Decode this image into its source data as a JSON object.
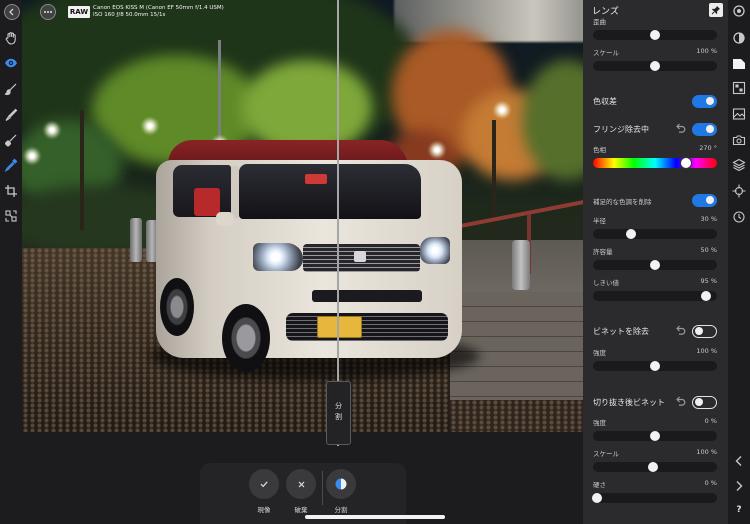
{
  "accent_color": "#1f78e3",
  "topbar": {
    "back_icon": "back-chevron-icon",
    "more_icon": "more-dots-icon",
    "raw_badge": "RAW",
    "camera_line1": "Canon EOS KISS M (Canon EF 50mm f/1.4 USM)",
    "camera_line2": "ISO 160 ƒ/8 50.0mm 15/1s"
  },
  "tools": [
    "hand-icon",
    "eye-icon",
    "brush-icon",
    "eraser-brush-icon",
    "gradient-brush-icon",
    "eyedropper-icon",
    "crop-icon",
    "red-eye-icon"
  ],
  "active_tool": "eye-icon",
  "split_handle": {
    "label": "分割"
  },
  "bottom_bar": {
    "buttons": [
      {
        "label": "現像",
        "icon": "check-icon"
      },
      {
        "label": "破棄",
        "icon": "close-icon"
      },
      {
        "label": "分割",
        "icon": "split-view-icon"
      }
    ]
  },
  "panel": {
    "title": "レンズ",
    "pin_icon": "pin-icon",
    "distortion": {
      "label": "歪曲",
      "fill": 0.5
    },
    "scale": {
      "label": "スケール",
      "value": "100 %",
      "fill": 0.5
    },
    "chromatic": {
      "label": "色収差",
      "on": true
    },
    "defringe": {
      "label": "フリンジ除去中",
      "on": true
    },
    "hue": {
      "label": "色相",
      "value": "270 °",
      "fill": 0.75
    },
    "remove_complementary": {
      "label": "補足的な色調を削除",
      "on": true
    },
    "radius": {
      "label": "半径",
      "value": "30 %",
      "fill": 0.31
    },
    "tolerance": {
      "label": "許容量",
      "value": "50 %",
      "fill": 0.5
    },
    "threshold": {
      "label": "しきい値",
      "value": "95 %",
      "fill": 0.91
    },
    "vignette": {
      "label": "ビネットを除去",
      "on": false
    },
    "vignette_strength": {
      "label": "強度",
      "value": "100 %",
      "fill": 0.5
    },
    "post_crop": {
      "label": "切り抜き後ビネット",
      "on": false
    },
    "post_crop_strength": {
      "label": "強度",
      "value": "0 %",
      "fill": 0.5
    },
    "post_crop_scale": {
      "label": "スケール",
      "value": "100 %",
      "fill": 0.48
    },
    "post_crop_hardness": {
      "label": "硬さ",
      "value": "0 %",
      "fill": 0.03
    }
  },
  "right_strip": {
    "icons": [
      "color-wheel-icon",
      "tone-icon",
      "lens-icon",
      "details-icon",
      "image-icon",
      "camera-icon",
      "layers-icon",
      "crosshair-icon",
      "history-icon",
      "chevron-left-icon",
      "chevron-right-icon"
    ],
    "active": "lens-icon",
    "help_label": "?"
  }
}
